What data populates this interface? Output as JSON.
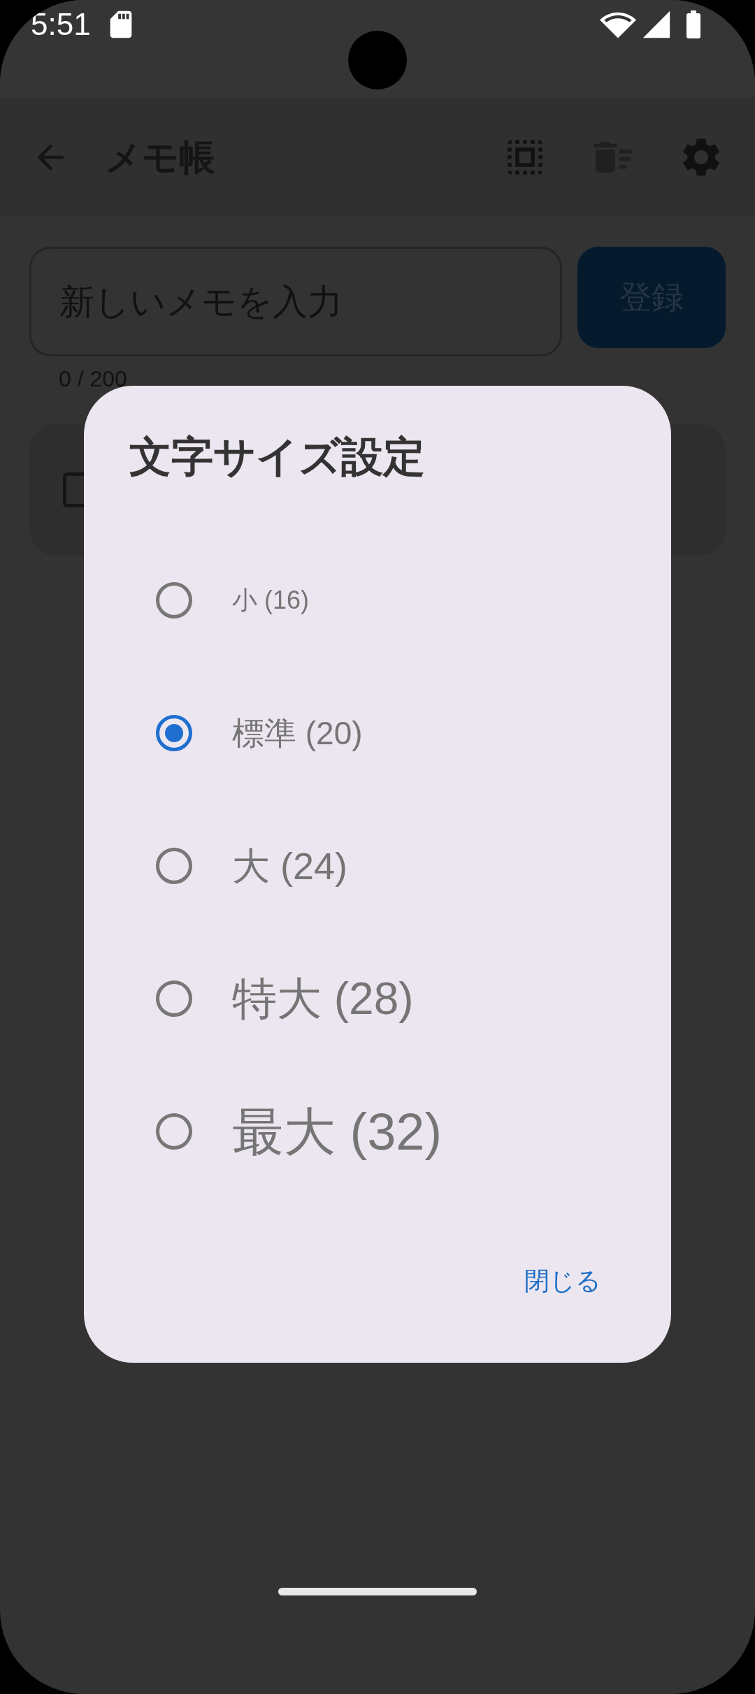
{
  "status_bar": {
    "time": "5:51"
  },
  "app_bar": {
    "title": "メモ帳",
    "actions": [
      {
        "kind": "select_all",
        "disabled": false
      },
      {
        "kind": "delete_sweep",
        "disabled": true
      },
      {
        "kind": "settings",
        "disabled": false
      }
    ]
  },
  "memo_input": {
    "placeholder": "新しいメモを入力",
    "counter": "0 / 200",
    "submit": {
      "label": "登録",
      "disabled": true
    }
  },
  "memos": [
    {
      "checked": false
    }
  ],
  "dialog": {
    "title": "文字サイズ設定",
    "options": [
      {
        "label": "小 (16)",
        "selected": false
      },
      {
        "label": "標準 (20)",
        "selected": true
      },
      {
        "label": "大 (24)",
        "selected": false
      },
      {
        "label": "特大 (28)",
        "selected": false
      },
      {
        "label": "最大 (32)",
        "selected": false
      }
    ],
    "close": "閉じる"
  }
}
